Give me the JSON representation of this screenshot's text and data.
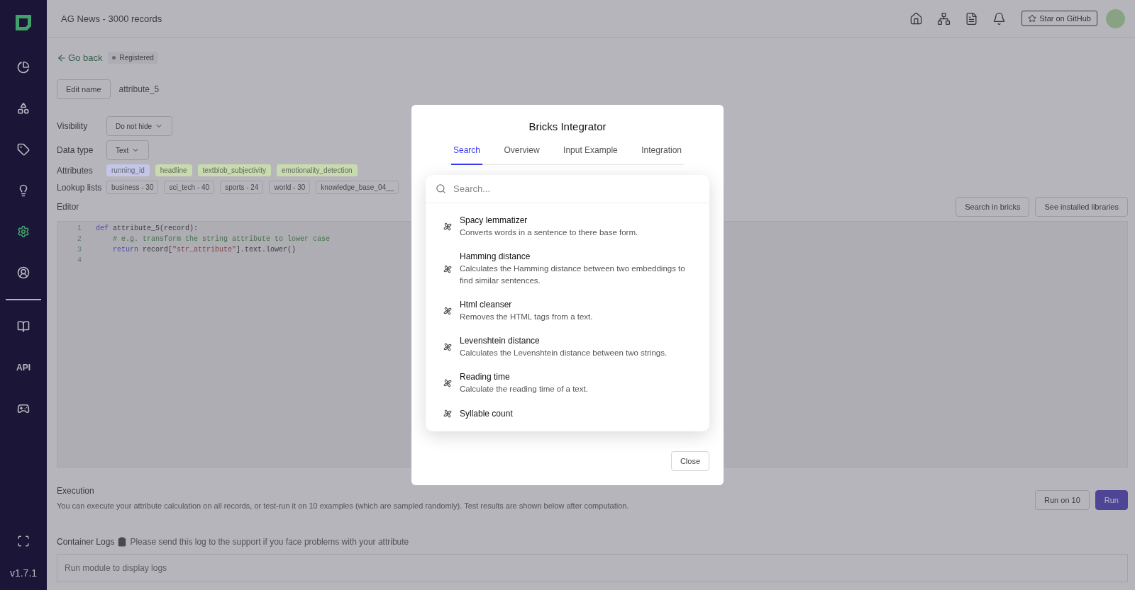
{
  "sidebar": {
    "items": [
      {
        "selected": false
      },
      {
        "selected": false
      },
      {
        "selected": false
      },
      {
        "selected": false
      },
      {
        "selected": true
      },
      {
        "selected": false
      },
      {
        "selected": false
      },
      {
        "selected": false,
        "label": "API"
      },
      {
        "selected": false
      }
    ],
    "version": "v1.7.1"
  },
  "header": {
    "title": "AG News - 3000 records",
    "star_button": "Star on GitHub"
  },
  "page": {
    "back_link": "Go back",
    "status": "Registered",
    "edit_name_button": "Edit name",
    "attribute_name": "attribute_5",
    "visibility": {
      "label": "Visibility",
      "value": "Do not hide"
    },
    "data_type": {
      "label": "Data type",
      "value": "Text"
    },
    "attributes": {
      "label": "Attributes",
      "items": [
        {
          "name": "running_id",
          "color": "#c3c6e8"
        },
        {
          "name": "headline",
          "color": "#c8dbae"
        },
        {
          "name": "textblob_subjectivity",
          "color": "#c8dbae"
        },
        {
          "name": "emotionality_detection",
          "color": "#c8dbae"
        }
      ]
    },
    "lookup_lists": {
      "label": "Lookup lists",
      "items": [
        "business - 30",
        "sci_tech - 40",
        "sports - 24",
        "world - 30",
        "knowledge_base_04__"
      ]
    },
    "editor": {
      "label": "Editor",
      "buttons": [
        "Search in bricks",
        "See installed libraries"
      ],
      "lines": [
        {
          "number": "1",
          "tokens": [
            {
              "kind": "keyword",
              "text": "def"
            },
            {
              "kind": "plain",
              "text": " attribute_5(record):"
            }
          ]
        },
        {
          "number": "2",
          "tokens": [
            {
              "kind": "comment",
              "text": "    # e.g. transform the string attribute to lower case"
            }
          ]
        },
        {
          "number": "3",
          "tokens": [
            {
              "kind": "keyword",
              "text": "    return"
            },
            {
              "kind": "plain",
              "text": " record["
            },
            {
              "kind": "string",
              "text": "\"str_attribute\""
            },
            {
              "kind": "plain",
              "text": "].text.lower()"
            }
          ]
        },
        {
          "number": "4"
        }
      ]
    },
    "execution": {
      "title": "Execution",
      "description": "You can execute your attribute calculation on all records, or test-run it on 10 examples (which are sampled randomly). Test results are shown below after computation.",
      "buttons": [
        {
          "label": "Run on 10",
          "kind": "secondary"
        },
        {
          "label": "Run",
          "kind": "primary"
        }
      ]
    },
    "logs": {
      "title": "Container Logs",
      "hint": "Please send this log to the support if you face problems with your attribute",
      "placeholder": "Run module to display logs"
    }
  },
  "modal": {
    "title": "Bricks Integrator",
    "tabs": [
      {
        "label": "Search",
        "selected": true
      },
      {
        "label": "Overview",
        "selected": false
      },
      {
        "label": "Input Example",
        "selected": false
      },
      {
        "label": "Integration",
        "selected": false
      }
    ],
    "search": {
      "placeholder": "Search..."
    },
    "results": [
      {
        "title": "Spacy lemmatizer",
        "description": "Converts words in a sentence to there base form."
      },
      {
        "title": "Hamming distance",
        "description": "Calculates the Hamming distance between two embeddings to find similar sentences."
      },
      {
        "title": "Html cleanser",
        "description": "Removes the HTML tags from a text."
      },
      {
        "title": "Levenshtein distance",
        "description": "Calculates the Levenshtein distance between two strings."
      },
      {
        "title": "Reading time",
        "description": "Calculate the reading time of a text."
      },
      {
        "title": "Syllable count"
      }
    ],
    "close_button": "Close"
  }
}
